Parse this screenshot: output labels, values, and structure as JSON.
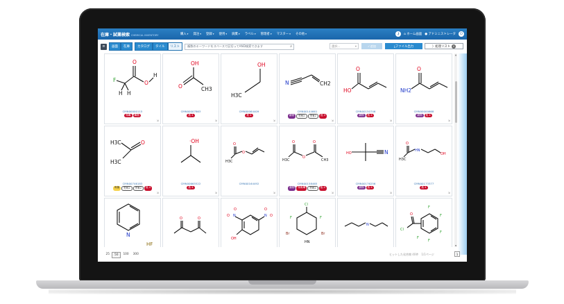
{
  "app": {
    "logo": "在庫・試薬検索",
    "logo_sub": "CHEMICAL INVENTORY"
  },
  "nav": [
    {
      "label": "購入"
    },
    {
      "label": "発注"
    },
    {
      "label": "登録"
    },
    {
      "label": "使用"
    },
    {
      "label": "廃棄"
    },
    {
      "label": "ラベル"
    },
    {
      "label": "管理者"
    },
    {
      "label": "マスター"
    },
    {
      "label": "その他"
    }
  ],
  "header_right": {
    "home_label": "ホーム画面",
    "user_label": "アドミニストレータ"
  },
  "toolbar": {
    "menu_icon": "hamburger-icon",
    "view_toggle": [
      "画面",
      "在庫"
    ],
    "display_toggle": [
      "カタログ",
      "タイル",
      "リスト"
    ],
    "search_placeholder": "複数のキーワードをスペースで区切ってAND検索できます",
    "select_placeholder": "選択...",
    "add_label": "追加",
    "file_label": "ファイル出力",
    "list_label": "処理リスト",
    "list_count": "0"
  },
  "cards": [
    {
      "id": "CMN00000115",
      "badges": [
        {
          "text": "特毒",
          "color": "red"
        },
        {
          "text": "毒物",
          "color": "red"
        }
      ]
    },
    {
      "id": "CMN00007863",
      "badges": [
        {
          "text": "危 4",
          "color": "red"
        }
      ]
    },
    {
      "id": "CMN00064409",
      "badges": [
        {
          "text": "危 4",
          "color": "red"
        }
      ]
    },
    {
      "id": "CMN00144661",
      "badges": [
        {
          "text": "劇物",
          "color": "purple"
        },
        {
          "text": "労有2",
          "color": "outline"
        },
        {
          "text": "労有2",
          "color": "outline"
        },
        {
          "text": "危 4",
          "color": "red"
        }
      ]
    },
    {
      "id": "CMN00150746",
      "badges": [
        {
          "text": "劇物",
          "color": "purple"
        },
        {
          "text": "危 4",
          "color": "red"
        }
      ]
    },
    {
      "id": "CMN00000668",
      "badges": [
        {
          "text": "劇物",
          "color": "purple"
        },
        {
          "text": "危 4",
          "color": "red"
        }
      ]
    },
    {
      "id": "CMN00746183",
      "badges": [
        {
          "text": "有機",
          "color": "yellow"
        },
        {
          "text": "労有2",
          "color": "outline"
        },
        {
          "text": "労有2",
          "color": "outline"
        },
        {
          "text": "危 4",
          "color": "red"
        }
      ]
    },
    {
      "id": "CMN00665522",
      "badges": [
        {
          "text": "危 4",
          "color": "red"
        }
      ]
    },
    {
      "id": "CMN00164492",
      "badges": []
    },
    {
      "id": "CMN00158465",
      "badges": [
        {
          "text": "劇物",
          "color": "purple"
        },
        {
          "text": "特有毒",
          "color": "red"
        },
        {
          "text": "労有2",
          "color": "outline"
        },
        {
          "text": "危 4",
          "color": "red"
        }
      ]
    },
    {
      "id": "CMN00176256",
      "badges": [
        {
          "text": "劇物",
          "color": "purple"
        },
        {
          "text": "危 4",
          "color": "red"
        }
      ]
    },
    {
      "id": "CMN00173377",
      "badges": [
        {
          "text": "危 4",
          "color": "red"
        }
      ]
    },
    {
      "id": "",
      "badges": [],
      "extra": "HF"
    },
    {
      "id": "",
      "badges": []
    },
    {
      "id": "",
      "badges": []
    },
    {
      "id": "",
      "badges": []
    },
    {
      "id": "",
      "badges": []
    },
    {
      "id": "",
      "badges": []
    }
  ],
  "atoms": {
    "O": "O",
    "OH": "OH",
    "H": "H",
    "F": "F",
    "N": "N",
    "Cl": "Cl",
    "Br": "Br",
    "H3C": "H3C",
    "CH3": "CH3",
    "CH2": "CH2",
    "NH2": "NH2",
    "HO": "HO",
    "OH_dot": "·OH",
    "HN": "HN"
  },
  "footer": {
    "page_sizes": [
      "25",
      "50",
      "100",
      "300"
    ],
    "active_size": "50",
    "hits_text": "ヒットした化合物 40件　1/1ページ",
    "page": "1"
  }
}
